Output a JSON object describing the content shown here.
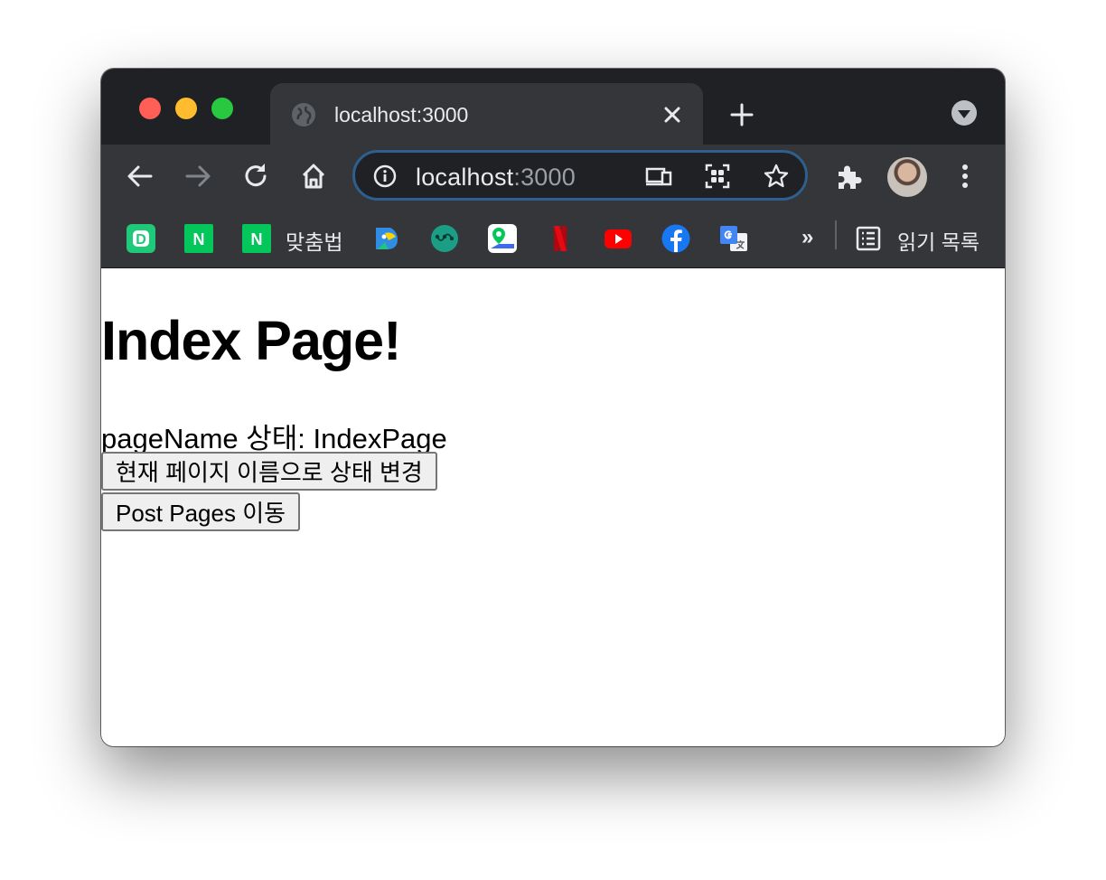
{
  "tab": {
    "title": "localhost:3000"
  },
  "omnibox": {
    "host": "localhost",
    "port": ":3000"
  },
  "bookmarks": {
    "items": [
      {
        "name": "D"
      },
      {
        "name": "N"
      },
      {
        "name": "N",
        "label": "맞춤법"
      }
    ],
    "more": "»",
    "reading_list": "읽기 목록"
  },
  "page": {
    "heading": "Index Page!",
    "status_text": "pageName 상태: IndexPage",
    "change_button": "현재 페이지 이름으로 상태 변경",
    "post_button": "Post Pages 이동"
  },
  "colors": {
    "tabstrip": "#202124",
    "toolbar": "#35363a",
    "omnibox_focus": "#2d5f8f",
    "close": "#ff5f57",
    "minimize": "#febc2e",
    "zoom": "#28c840"
  }
}
